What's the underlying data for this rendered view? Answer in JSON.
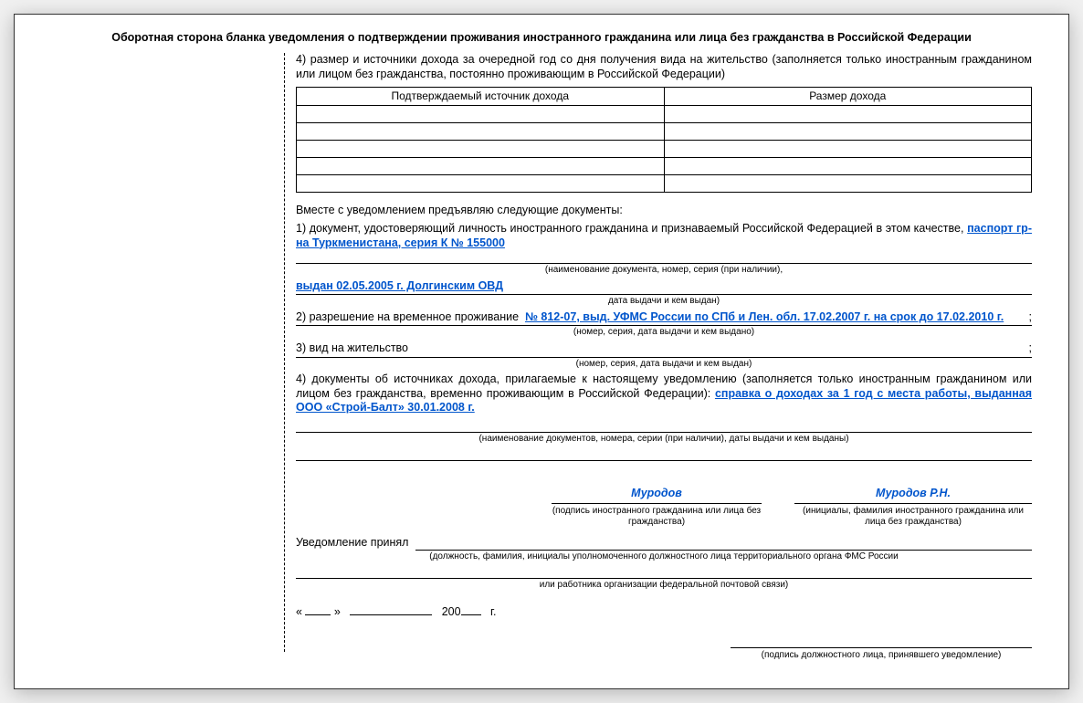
{
  "title": "Оборотная сторона бланка уведомления о подтверждении проживания иностранного гражданина или лица без гражданства в Российской Федерации",
  "section4": "4) размер и источники дохода за очередной год со дня получения вида на жительство (заполняется только иностранным гражданином или лицом без гражданства, постоянно проживающим в Российской Федерации)",
  "table": {
    "col1": "Подтверждаемый источник дохода",
    "col2": "Размер дохода"
  },
  "docs_intro": "Вместе с уведомлением предъявляю следующие документы:",
  "item1_label": "1) документ, удостоверяющий личность иностранного гражданина и признаваемый Российской Федерацией в этом качестве,",
  "item1_value": "паспорт гр-на Туркменистана, серия К № 155000",
  "item1_hint": "(наименование документа, номер, серия (при наличии),",
  "item1_line2": "выдан  02.05.2005 г. Долгинским ОВД",
  "item1_hint2": "дата выдачи и кем выдан)",
  "item2_label": "2) разрешение на временное проживание",
  "item2_value": "№ 812-07, выд. УФМС России по СПб и Лен. обл. 17.02.2007 г. на срок до 17.02.2010 г.",
  "item2_hint": "(номер, серия, дата выдачи и кем выдано)",
  "item3_label": "3) вид на жительство",
  "item3_hint": "(номер, серия, дата выдачи и кем выдан)",
  "item4_label": "4) документы об источниках дохода, прилагаемые к настоящему уведомлению (заполняется только иностранным гражданином или лицом без гражданства, временно проживающим в Российской Федерации):",
  "item4_value": "справка о доходах за 1 год с места работы, выданная ООО «Строй-Балт» 30.01.2008 г.",
  "item4_hint": "(наименование документов, номера, серии (при наличии), даты выдачи и кем выданы)",
  "sig1_name": "Муродов",
  "sig1_hint": "(подпись иностранного гражданина или лица без гражданства)",
  "sig2_name": "Муродов Р.Н.",
  "sig2_hint": "(инициалы, фамилия иностранного гражданина или лица без гражданства)",
  "accept_label": "Уведомление принял",
  "accept_hint": "(должность, фамилия, инициалы уполномоченного должностного лица территориального органа ФМС России",
  "accept_hint2": "или работника организации федеральной почтовой связи)",
  "date_prefix": "«",
  "date_mid": "»",
  "date_year": "200",
  "date_suffix": "г.",
  "final_hint": "(подпись должностного лица, принявшего уведомление)"
}
